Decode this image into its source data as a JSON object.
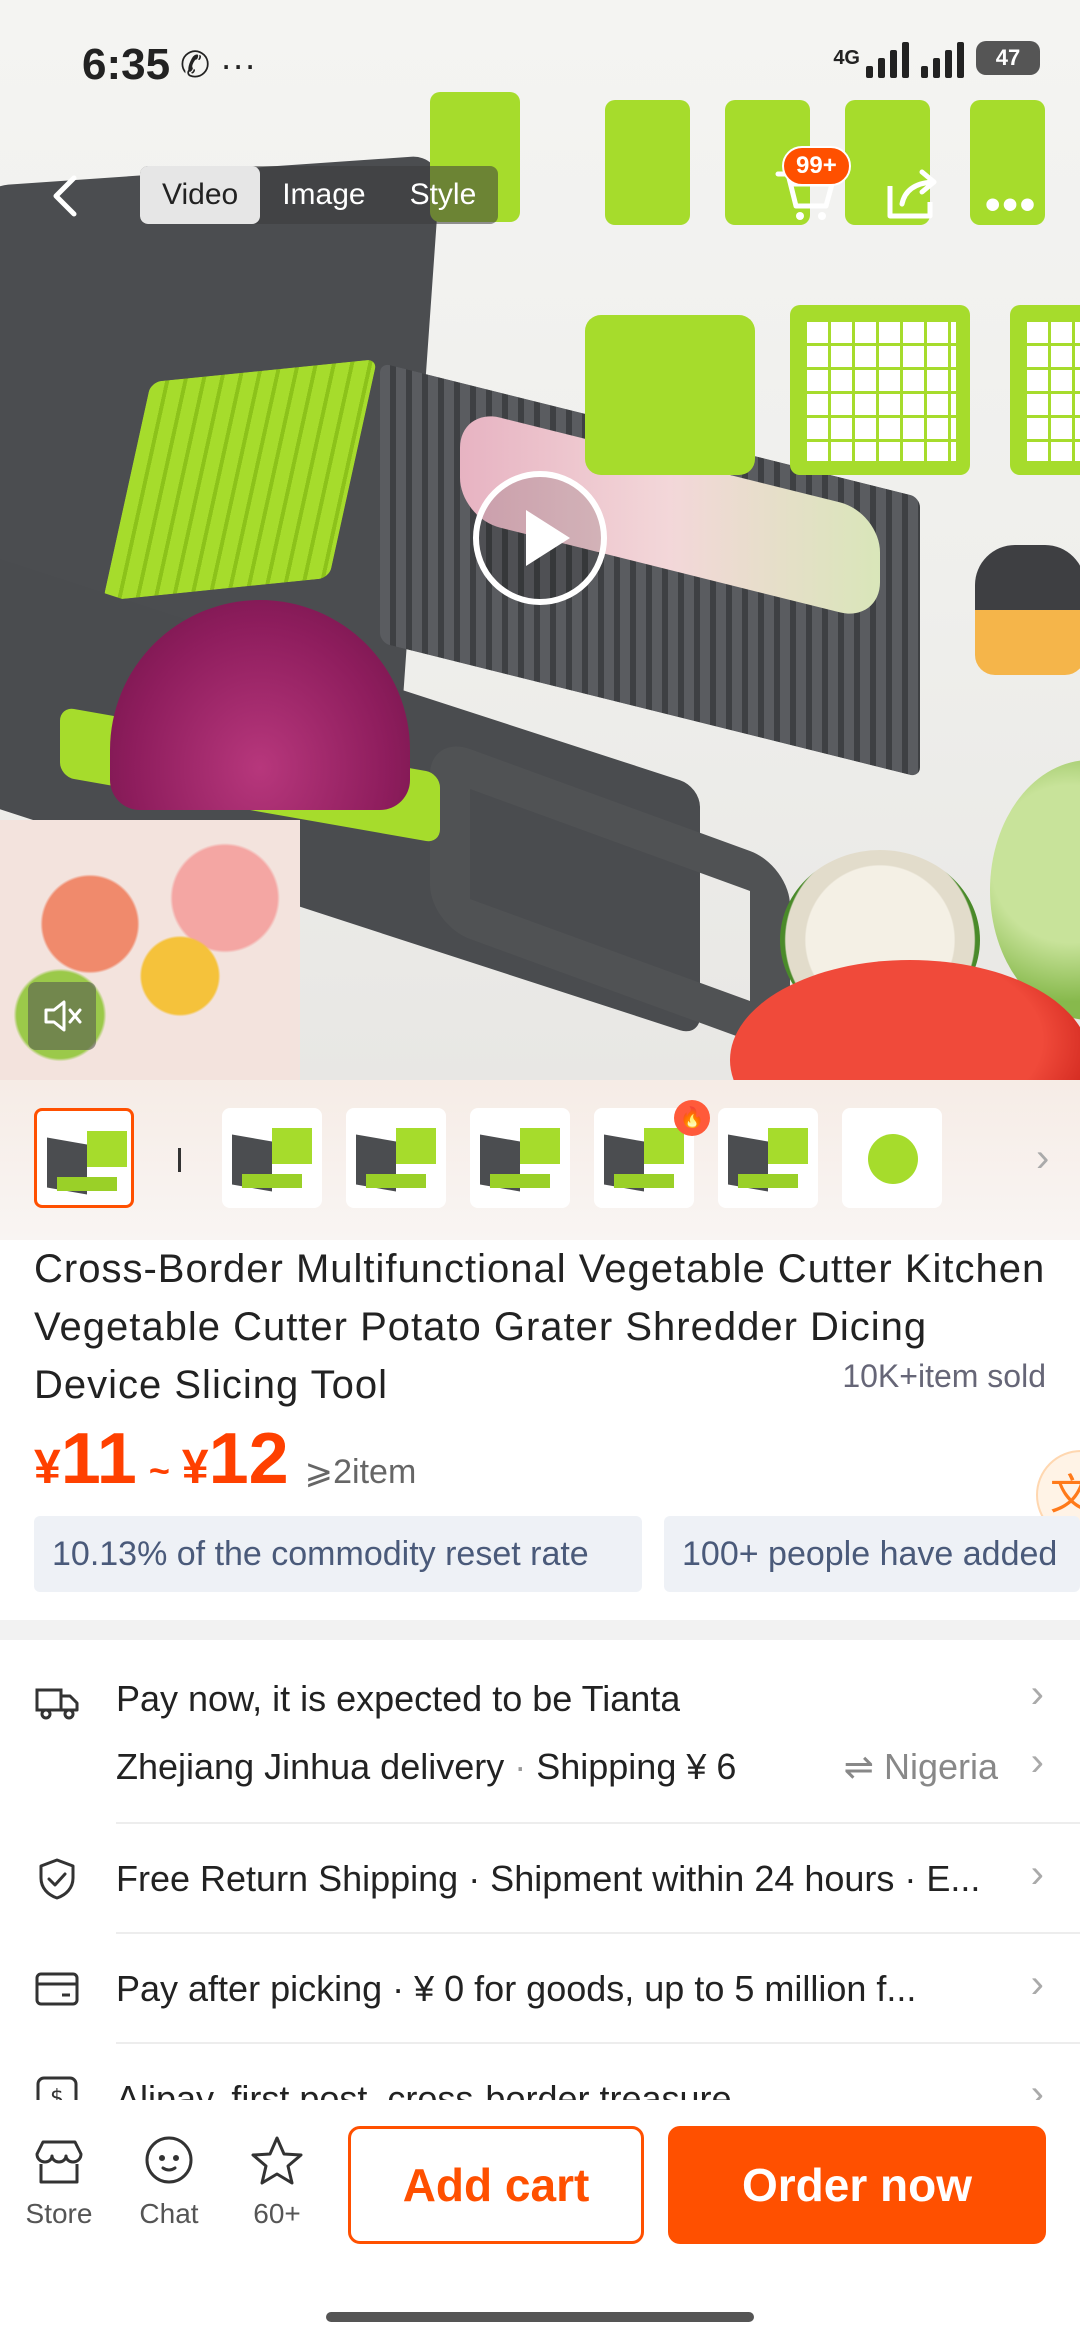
{
  "status_bar": {
    "time": "6:35",
    "left_icons": "✆ ···",
    "network": "4G",
    "battery": "47"
  },
  "nav": {
    "tabs": [
      "Video",
      "Image",
      "Style"
    ],
    "active_tab": "Video",
    "cart_badge": "99+",
    "more": "•••"
  },
  "thumbnails": {
    "count": 7,
    "selected_index": 0,
    "hot_index": 4,
    "fire_glyph": "🔥",
    "arrow": "›"
  },
  "product": {
    "title": "Cross-Border Multifunctional Vegetable Cutter Kitchen Vegetable Cutter Potato Grater Shredder Dicing Device Slicing Tool",
    "sold": "10K+item sold",
    "price": {
      "currency": "¥",
      "low": "11",
      "separator": "~",
      "high": "12",
      "min_order": "⩾2item"
    },
    "chips": [
      "10.13% of the commodity reset rate",
      "100+ people have added"
    ],
    "translate_glyph": "文"
  },
  "service": {
    "shipping_line1": "Pay now, it is expected to be Tianta",
    "origin": "Zhejiang Jinhua delivery",
    "shipping_fee": "Shipping ¥ 6",
    "destination": "⇌ Nigeria",
    "returns": "Free Return Shipping · Shipment within 24 hours · E...",
    "pay_after": "Pay after picking · ¥ 0 for goods, up to 5 million f...",
    "alipay": "Alipay, first post, cross-border treasure",
    "separator": " · ",
    "chevron": "›"
  },
  "bottom_bar": {
    "store": "Store",
    "chat": "Chat",
    "favorites": "60+",
    "add_cart": "Add cart",
    "order_now": "Order now"
  },
  "colors": {
    "accent": "#ff5000",
    "chip_bg": "#eef1f6",
    "chip_text": "#4a5a7a"
  }
}
